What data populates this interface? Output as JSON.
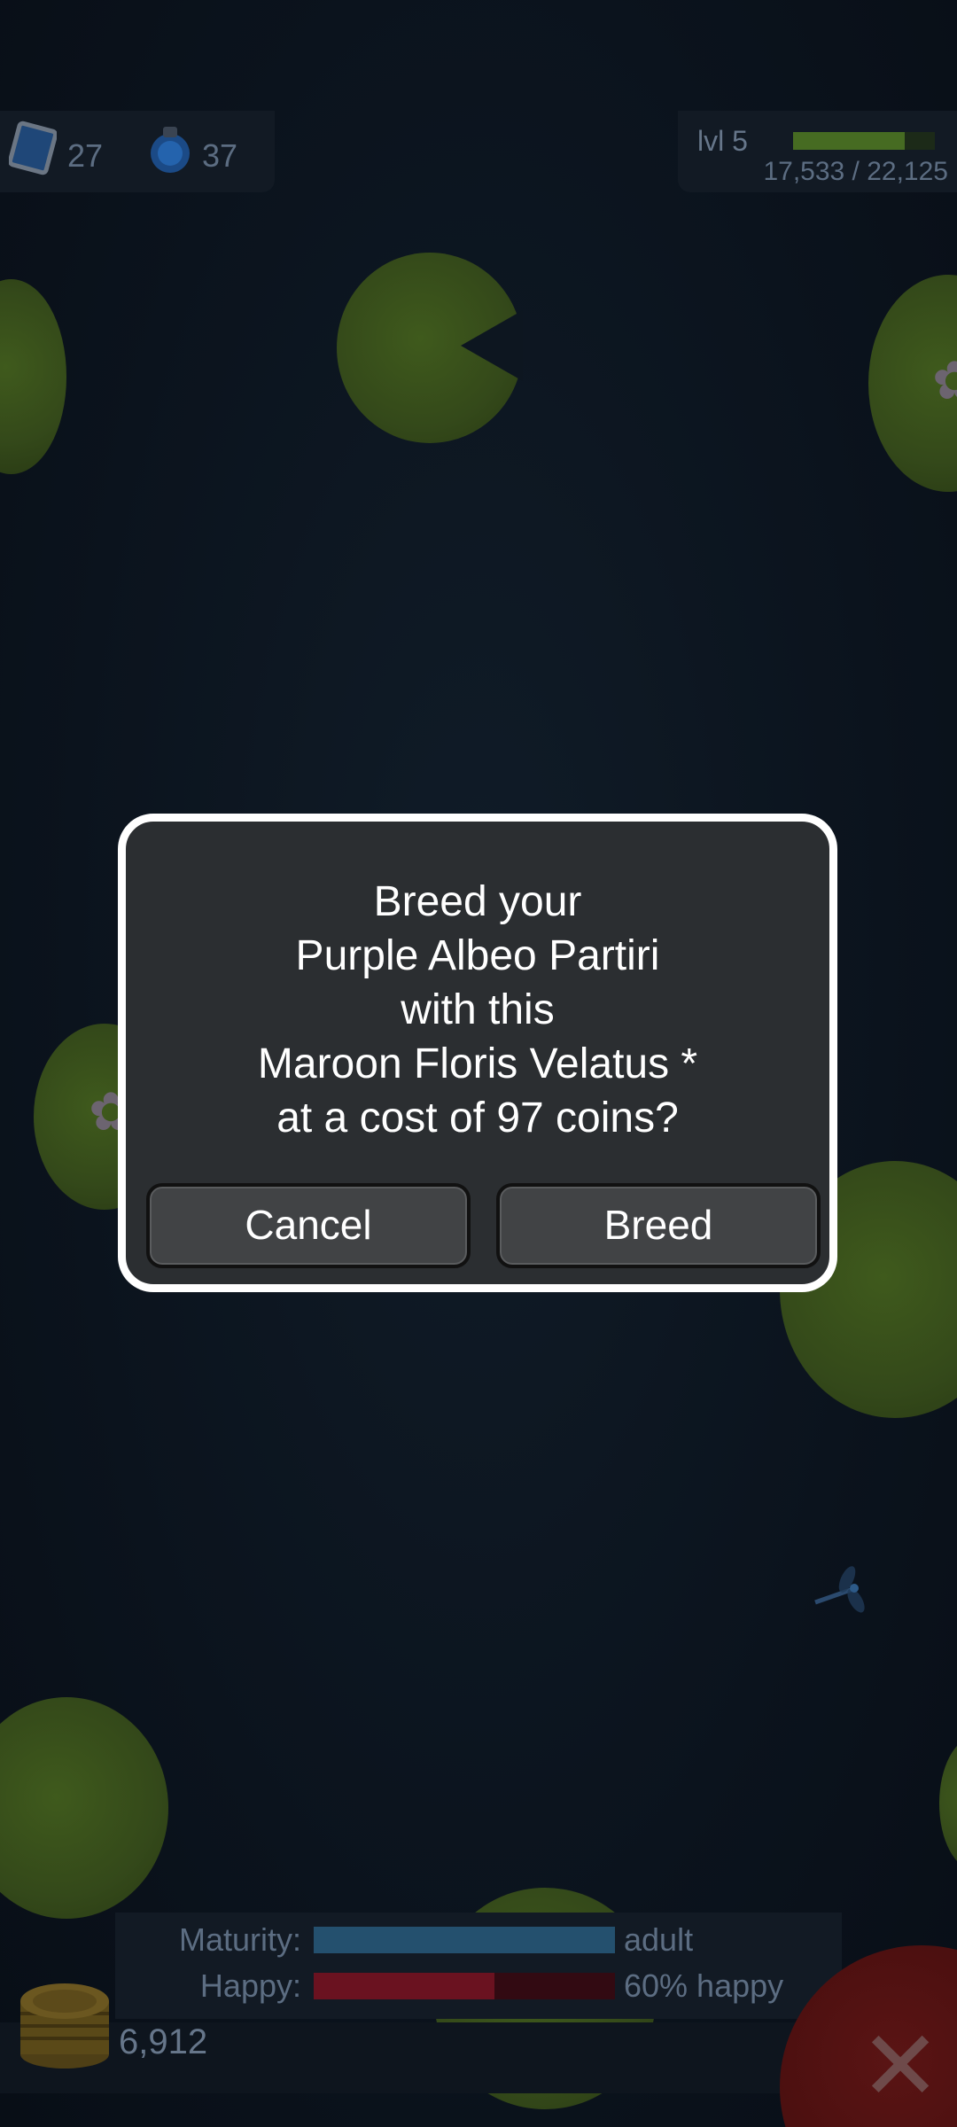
{
  "hud": {
    "gems": "27",
    "potions": "37",
    "level": "lvl 5",
    "xp": "17,533 / 22,125",
    "xp_progress": 0.79
  },
  "dialog": {
    "lines": [
      "Breed your",
      "Purple Albeo Partiri",
      "with this",
      "Maroon Floris Velatus *",
      "at a cost of 97 coins?"
    ],
    "cancel_label": "Cancel",
    "breed_label": "Breed"
  },
  "stats": {
    "maturity_label": "Maturity:",
    "maturity_value": "adult",
    "maturity_progress": 1.0,
    "happy_label": "Happy:",
    "happy_value": "60% happy",
    "happy_progress": 0.6
  },
  "coins": "6,912",
  "colors": {
    "dialog_bg": "#2b2e31",
    "dialog_border": "#ffffff",
    "button_bg": "#414345",
    "maturity_bar": "#24506e",
    "happy_bar": "#6a1220",
    "xp_bar": "#466b22",
    "pad": "#34491a"
  },
  "icons": {
    "gem": "blue-stamp-gem-icon",
    "potion": "blue-potion-icon",
    "coins": "gold-coin-stack-icon",
    "close": "close-x-icon",
    "dragonfly": "dragonfly-icon"
  }
}
